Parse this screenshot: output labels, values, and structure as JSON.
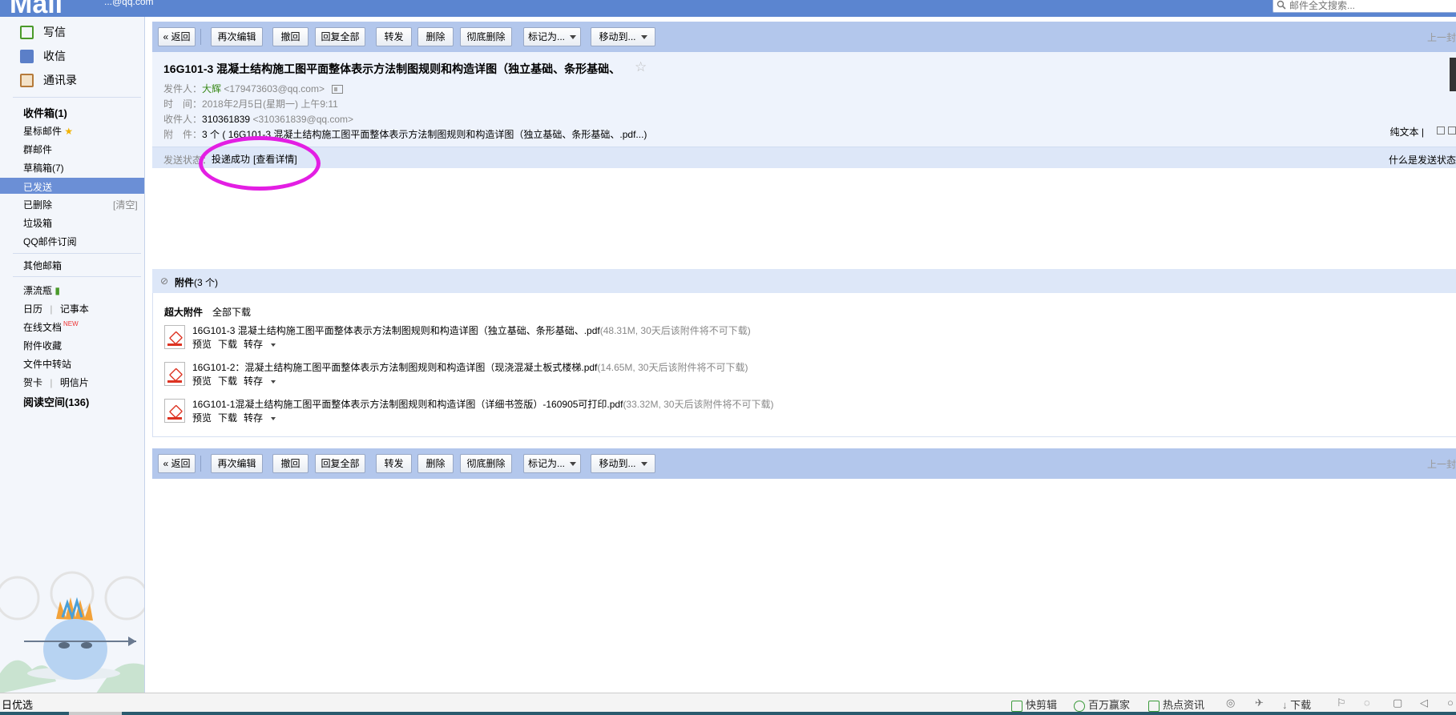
{
  "header": {
    "brand": "Mail",
    "account": "...@qq.com",
    "search_placeholder": "邮件全文搜索..."
  },
  "sidebar": {
    "compose": "写信",
    "receive": "收信",
    "contacts": "通讯录",
    "inbox": "收件箱(1)",
    "starred": "星标邮件",
    "group": "群邮件",
    "drafts": "草稿箱(7)",
    "sent": "已发送",
    "deleted": "已删除",
    "clear": "[清空]",
    "spam": "垃圾箱",
    "subscriptions": "QQ邮件订阅",
    "other_mail": "其他邮箱",
    "drift_bottle": "漂流瓶",
    "calendar": "日历",
    "notes": "记事本",
    "online_docs": "在线文档",
    "new_badge": "NEW",
    "attach_collection": "附件收藏",
    "file_transfer": "文件中转站",
    "greeting_card": "贺卡",
    "postcard": "明信片",
    "reading_space": "阅读空间(136)"
  },
  "toolbar": {
    "back": "« 返回",
    "reedit": "再次编辑",
    "recall": "撤回",
    "reply_all": "回复全部",
    "forward": "转发",
    "delete": "删除",
    "delete_perm": "彻底删除",
    "mark_as": "标记为...",
    "move_to": "移动到...",
    "prev": "上一封"
  },
  "mail": {
    "subject": "16G101-3 混凝土结构施工图平面整体表示方法制图规则和构造详图（独立基础、条形基础、",
    "from_label": "发件人：",
    "from_name": "大辉",
    "from_addr": "<179473603@qq.com>",
    "time_label": "时　间：",
    "time": "2018年2月5日(星期一) 上午9:11",
    "to_label": "收件人：",
    "to_name": "310361839",
    "to_addr": "<310361839@qq.com>",
    "att_label": "附　件：",
    "att_summary": "3 个 ( 16G101-3 混凝土结构施工图平面整体表示方法制图规则和构造详图（独立基础、条形基础、.pdf...)",
    "plain_text": "纯文本 |",
    "send_status_label": "发送状态：",
    "send_status": "投递成功",
    "view_detail": "[查看详情]",
    "what_is_status": "什么是发送状态"
  },
  "attachments": {
    "title": "附件",
    "count": "(3 个)",
    "super_label": "超大附件",
    "download_all": "全部下载",
    "preview": "预览",
    "download": "下载",
    "save_to": "转存",
    "items": [
      {
        "name": "16G101-3 混凝土结构施工图平面整体表示方法制图规则和构造详图（独立基础、条形基础、.pdf",
        "size": "(48.31M, 30天后该附件将不可下载)"
      },
      {
        "name": "16G101-2：混凝土结构施工图平面整体表示方法制图规则和构造详图（现浇混凝土板式楼梯.pdf",
        "size": "(14.65M, 30天后该附件将不可下载)"
      },
      {
        "name": "16G101-1混凝土结构施工图平面整体表示方法制图规则和构造详图（详细书签版）-160905可打印.pdf",
        "size": "(33.32M, 30天后该附件将不可下载)"
      }
    ]
  },
  "statusbar": {
    "left": "日优选",
    "clip": "快剪辑",
    "millionaire": "百万赢家",
    "news": "热点资讯",
    "download": "下载"
  },
  "colors": {
    "header_blue": "#5b85d0",
    "toolbar_blue": "#b3c7ec",
    "selected_blue": "#6b8fd6",
    "highlight_magenta": "#e31ee3",
    "sender_green": "#3a8a1a"
  }
}
